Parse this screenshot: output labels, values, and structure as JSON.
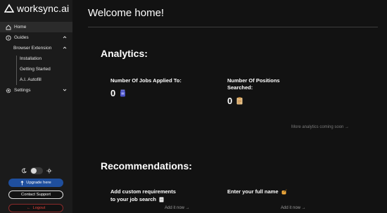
{
  "app": {
    "name": "worksync.ai"
  },
  "sidebar": {
    "items": [
      {
        "label": "Home",
        "icon": "home-icon"
      },
      {
        "label": "Guides",
        "icon": "info-icon"
      },
      {
        "label": "Browser Extension"
      },
      {
        "label": "Installation"
      },
      {
        "label": "Getting Started"
      },
      {
        "label": "A.I. Autofill"
      },
      {
        "label": "Settings",
        "icon": "gear-icon"
      }
    ],
    "upgrade_label": "Upgrade here",
    "support_label": "Contact Support",
    "logout_label": "Logout"
  },
  "main": {
    "welcome": "Welcome home!",
    "analytics": {
      "title": "Analytics:",
      "jobs_applied_label": "Number Of Jobs Applied To:",
      "jobs_applied_value": "0",
      "positions_searched_label_line1": "Number Of Positions",
      "positions_searched_label_line2": "Searched:",
      "positions_searched_value": "0",
      "more_text": "More analytics coming soon →"
    },
    "recommendations": {
      "title": "Recommendations:",
      "rec1_line1": "Add custom requirements",
      "rec1_line2": "to your job search",
      "rec1_link": "Add it now →",
      "rec2_label": "Enter your full name",
      "rec2_link": "Add it now →"
    }
  },
  "colors": {
    "background": "#121212",
    "sidebar": "#1b1b1b",
    "accent_blue": "#1f4f9e",
    "logout_red": "#e0433b"
  }
}
